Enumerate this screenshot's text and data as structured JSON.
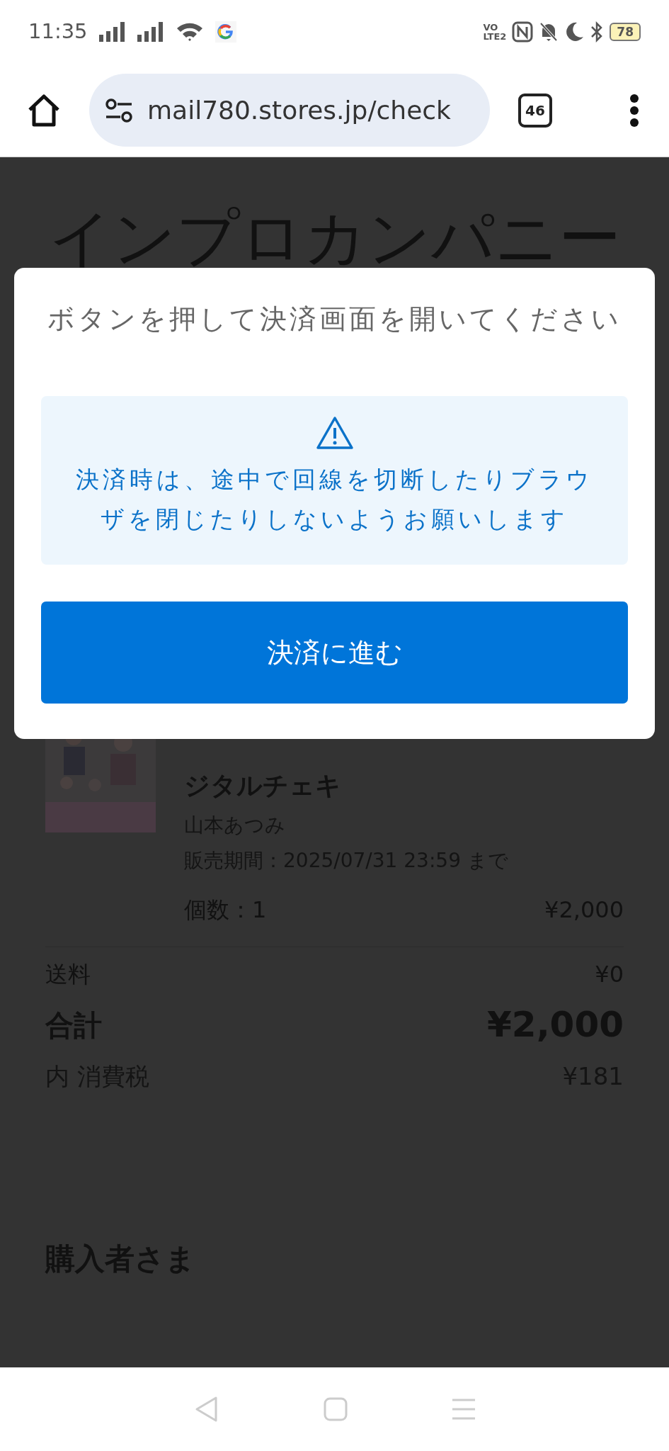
{
  "status_bar": {
    "time": "11:35",
    "network_label": [
      "VO",
      "LTE2"
    ],
    "battery": "78"
  },
  "browser": {
    "url": "mail780.stores.jp/check",
    "tab_count": "46"
  },
  "page": {
    "shop_title": "インプロカンパニー",
    "item": {
      "name": "ジタルチェキ",
      "artist": "山本あつみ",
      "sale_period": "販売期間：2025/07/31 23:59 まで",
      "quantity": "個数：1",
      "price": "¥2,000"
    },
    "summary": [
      {
        "kind": "normal",
        "label": "送料",
        "value": "¥0"
      },
      {
        "kind": "total",
        "label": "合計",
        "value": "¥2,000"
      },
      {
        "kind": "tax",
        "label": "内 消費税",
        "value": "¥181"
      }
    ],
    "section_heading": "購入者さま"
  },
  "modal": {
    "title": "ボタンを押して決済画面を開いてください",
    "notice": "決済時は、途中で回線を切断したりブラウザを閉じたりしないようお願いします",
    "button": "決済に進む"
  }
}
